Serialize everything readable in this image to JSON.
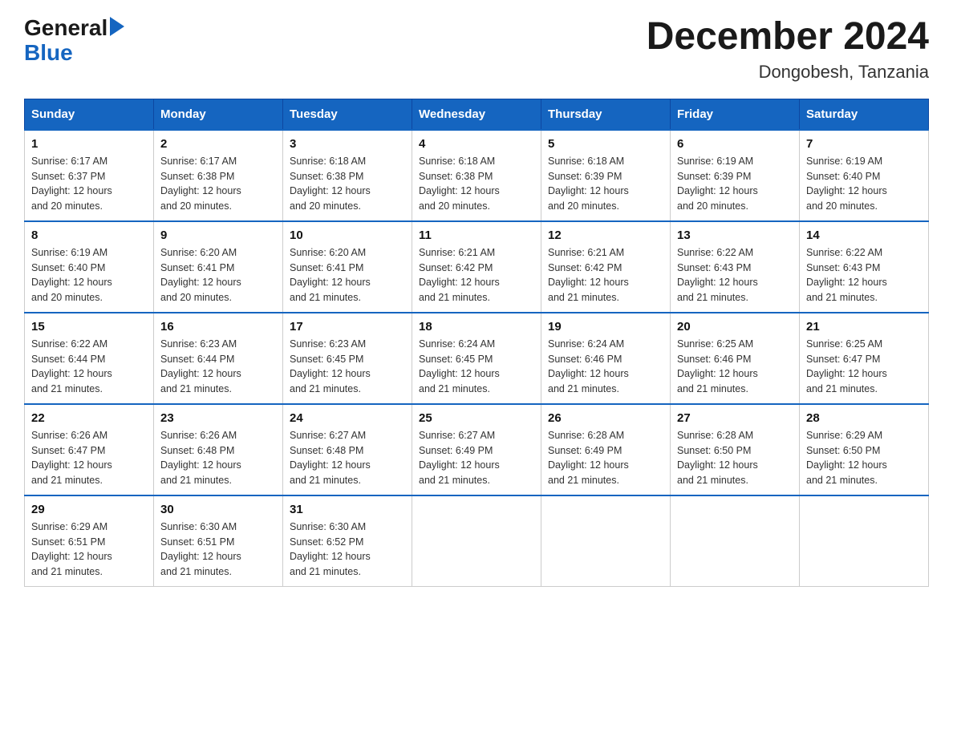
{
  "logo": {
    "general": "General",
    "blue": "Blue"
  },
  "title": "December 2024",
  "subtitle": "Dongobesh, Tanzania",
  "days_of_week": [
    "Sunday",
    "Monday",
    "Tuesday",
    "Wednesday",
    "Thursday",
    "Friday",
    "Saturday"
  ],
  "weeks": [
    [
      {
        "day": "1",
        "sunrise": "6:17 AM",
        "sunset": "6:37 PM",
        "daylight": "12 hours and 20 minutes."
      },
      {
        "day": "2",
        "sunrise": "6:17 AM",
        "sunset": "6:38 PM",
        "daylight": "12 hours and 20 minutes."
      },
      {
        "day": "3",
        "sunrise": "6:18 AM",
        "sunset": "6:38 PM",
        "daylight": "12 hours and 20 minutes."
      },
      {
        "day": "4",
        "sunrise": "6:18 AM",
        "sunset": "6:38 PM",
        "daylight": "12 hours and 20 minutes."
      },
      {
        "day": "5",
        "sunrise": "6:18 AM",
        "sunset": "6:39 PM",
        "daylight": "12 hours and 20 minutes."
      },
      {
        "day": "6",
        "sunrise": "6:19 AM",
        "sunset": "6:39 PM",
        "daylight": "12 hours and 20 minutes."
      },
      {
        "day": "7",
        "sunrise": "6:19 AM",
        "sunset": "6:40 PM",
        "daylight": "12 hours and 20 minutes."
      }
    ],
    [
      {
        "day": "8",
        "sunrise": "6:19 AM",
        "sunset": "6:40 PM",
        "daylight": "12 hours and 20 minutes."
      },
      {
        "day": "9",
        "sunrise": "6:20 AM",
        "sunset": "6:41 PM",
        "daylight": "12 hours and 20 minutes."
      },
      {
        "day": "10",
        "sunrise": "6:20 AM",
        "sunset": "6:41 PM",
        "daylight": "12 hours and 21 minutes."
      },
      {
        "day": "11",
        "sunrise": "6:21 AM",
        "sunset": "6:42 PM",
        "daylight": "12 hours and 21 minutes."
      },
      {
        "day": "12",
        "sunrise": "6:21 AM",
        "sunset": "6:42 PM",
        "daylight": "12 hours and 21 minutes."
      },
      {
        "day": "13",
        "sunrise": "6:22 AM",
        "sunset": "6:43 PM",
        "daylight": "12 hours and 21 minutes."
      },
      {
        "day": "14",
        "sunrise": "6:22 AM",
        "sunset": "6:43 PM",
        "daylight": "12 hours and 21 minutes."
      }
    ],
    [
      {
        "day": "15",
        "sunrise": "6:22 AM",
        "sunset": "6:44 PM",
        "daylight": "12 hours and 21 minutes."
      },
      {
        "day": "16",
        "sunrise": "6:23 AM",
        "sunset": "6:44 PM",
        "daylight": "12 hours and 21 minutes."
      },
      {
        "day": "17",
        "sunrise": "6:23 AM",
        "sunset": "6:45 PM",
        "daylight": "12 hours and 21 minutes."
      },
      {
        "day": "18",
        "sunrise": "6:24 AM",
        "sunset": "6:45 PM",
        "daylight": "12 hours and 21 minutes."
      },
      {
        "day": "19",
        "sunrise": "6:24 AM",
        "sunset": "6:46 PM",
        "daylight": "12 hours and 21 minutes."
      },
      {
        "day": "20",
        "sunrise": "6:25 AM",
        "sunset": "6:46 PM",
        "daylight": "12 hours and 21 minutes."
      },
      {
        "day": "21",
        "sunrise": "6:25 AM",
        "sunset": "6:47 PM",
        "daylight": "12 hours and 21 minutes."
      }
    ],
    [
      {
        "day": "22",
        "sunrise": "6:26 AM",
        "sunset": "6:47 PM",
        "daylight": "12 hours and 21 minutes."
      },
      {
        "day": "23",
        "sunrise": "6:26 AM",
        "sunset": "6:48 PM",
        "daylight": "12 hours and 21 minutes."
      },
      {
        "day": "24",
        "sunrise": "6:27 AM",
        "sunset": "6:48 PM",
        "daylight": "12 hours and 21 minutes."
      },
      {
        "day": "25",
        "sunrise": "6:27 AM",
        "sunset": "6:49 PM",
        "daylight": "12 hours and 21 minutes."
      },
      {
        "day": "26",
        "sunrise": "6:28 AM",
        "sunset": "6:49 PM",
        "daylight": "12 hours and 21 minutes."
      },
      {
        "day": "27",
        "sunrise": "6:28 AM",
        "sunset": "6:50 PM",
        "daylight": "12 hours and 21 minutes."
      },
      {
        "day": "28",
        "sunrise": "6:29 AM",
        "sunset": "6:50 PM",
        "daylight": "12 hours and 21 minutes."
      }
    ],
    [
      {
        "day": "29",
        "sunrise": "6:29 AM",
        "sunset": "6:51 PM",
        "daylight": "12 hours and 21 minutes."
      },
      {
        "day": "30",
        "sunrise": "6:30 AM",
        "sunset": "6:51 PM",
        "daylight": "12 hours and 21 minutes."
      },
      {
        "day": "31",
        "sunrise": "6:30 AM",
        "sunset": "6:52 PM",
        "daylight": "12 hours and 21 minutes."
      },
      null,
      null,
      null,
      null
    ]
  ],
  "labels": {
    "sunrise": "Sunrise:",
    "sunset": "Sunset:",
    "daylight": "Daylight:"
  }
}
